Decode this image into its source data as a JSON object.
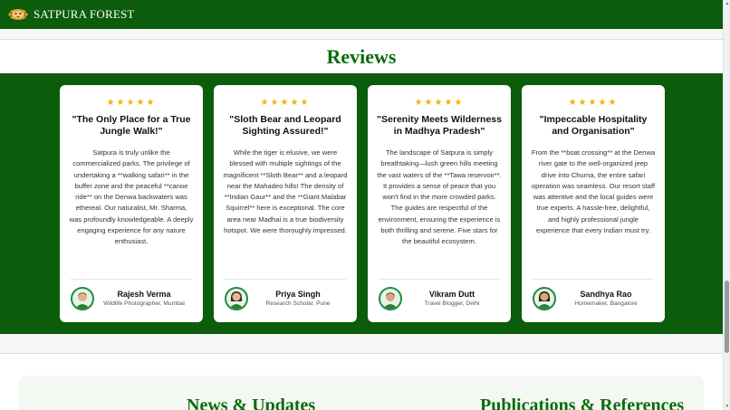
{
  "brand": {
    "name": "SATPURA FOREST",
    "logo_icon": "tiger-emblem-icon"
  },
  "reviews": {
    "title": "Reviews",
    "cards": [
      {
        "stars": "★★★★★",
        "title": "\"The Only Place for a True Jungle Walk!\"",
        "body": "Satpura is truly unlike the commercialized parks. The privilege of undertaking a **walking safari** in the buffer zone and the peaceful **canoe ride** on the Denwa backwaters was ethereal. Our naturalist, Mr. Sharma, was profoundly knowledgeable. A deeply engaging experience for any nature enthusiast.",
        "author": "Rajesh Verma",
        "role": "Wildlife Photographer, Mumbai",
        "avatar_icon": "male-avatar-icon"
      },
      {
        "stars": "★★★★★",
        "title": "\"Sloth Bear and Leopard Sighting Assured!\"",
        "body": "While the tiger is elusive, we were blessed with multiple sightings of the magnificent **Sloth Bear** and a leopard near the Mahadeo hills! The density of **Indian Gaur** and the **Giant Malabar Squirrel** here is exceptional. The core area near Madhai is a true biodiversity hotspot. We were thoroughly impressed.",
        "author": "Priya Singh",
        "role": "Research Scholar, Pune",
        "avatar_icon": "female-avatar-icon"
      },
      {
        "stars": "★★★★★",
        "title": "\"Serenity Meets Wilderness in Madhya Pradesh\"",
        "body": "The landscape of Satpura is simply breathtaking—lush green hills meeting the vast waters of the **Tawa reservoir**. It provides a sense of peace that you won't find in the more crowded parks. The guides are respectful of the environment, ensuring the experience is both thrilling and serene. Five stars for the beautiful ecosystem.",
        "author": "Vikram Dutt",
        "role": "Travel Blogger, Delhi",
        "avatar_icon": "male-avatar-icon"
      },
      {
        "stars": "★★★★★",
        "title": "\"Impeccable Hospitality and Organisation\"",
        "body": "From the **boat crossing** at the Denwa river gate to the well-organized jeep drive into Churna, the entire safari operation was seamless. Our resort staff was attentive and the local guides were true experts. A hassle-free, delightful, and highly professional jungle experience that every Indian must try.",
        "author": "Sandhya Rao",
        "role": "Homemaker, Bangalore",
        "avatar_icon": "female-avatar-icon"
      }
    ]
  },
  "lower": {
    "news_title": "News & Updates",
    "publications_title": "Publications & References"
  },
  "colors": {
    "primary_green": "#0b5c0b",
    "heading_green": "#0b6b0b",
    "star_gold": "#f2b50b",
    "avatar_ring": "#1e8e3e"
  }
}
